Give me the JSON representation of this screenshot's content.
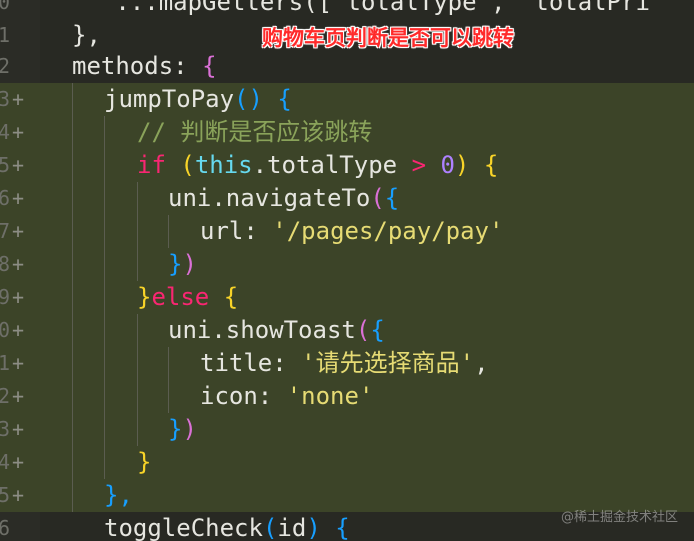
{
  "annotation": "购物车页判断是否可以跳转",
  "watermark": "@稀土掘金技术社区",
  "lines": [
    {
      "num": "0",
      "mark": "",
      "tokens": {
        "a": "   ...mapGetters([ totalType ,  totalPri"
      }
    },
    {
      "num": "1",
      "mark": "",
      "tokens": {
        "a": "},"
      }
    },
    {
      "num": "2",
      "mark": "",
      "tokens": {
        "a": "methods",
        "b": ":",
        "c": "{"
      }
    },
    {
      "num": "3",
      "mark": "+",
      "tokens": {
        "a": "jumpToPay",
        "b": "()",
        "c": "{"
      }
    },
    {
      "num": "4",
      "mark": "+",
      "tokens": {
        "a": "// 判断是否应该跳转"
      }
    },
    {
      "num": "5",
      "mark": "+",
      "tokens": {
        "a": "if",
        "b": "(",
        "c": "this",
        "d": ".totalType",
        "e": ">",
        "f": "0",
        "g": ")",
        "h": "{"
      }
    },
    {
      "num": "6",
      "mark": "+",
      "tokens": {
        "a": "uni",
        "b": ".navigateTo",
        "c": "(",
        "d": "{"
      }
    },
    {
      "num": "7",
      "mark": "+",
      "tokens": {
        "a": "url",
        "b": ":",
        "c": "'/pages/pay/pay'"
      }
    },
    {
      "num": "8",
      "mark": "+",
      "tokens": {
        "a": "}",
        "b": ")"
      }
    },
    {
      "num": "9",
      "mark": "+",
      "tokens": {
        "a": "}",
        "b": "else",
        "c": "{"
      }
    },
    {
      "num": "0",
      "mark": "+",
      "tokens": {
        "a": "uni",
        "b": ".showToast",
        "c": "(",
        "d": "{"
      }
    },
    {
      "num": "1",
      "mark": "+",
      "tokens": {
        "a": "title",
        "b": ":",
        "c": "'请先选择商品'",
        "d": ","
      }
    },
    {
      "num": "2",
      "mark": "+",
      "tokens": {
        "a": "icon",
        "b": ":",
        "c": "'none'"
      }
    },
    {
      "num": "3",
      "mark": "+",
      "tokens": {
        "a": "}",
        "b": ")"
      }
    },
    {
      "num": "4",
      "mark": "+",
      "tokens": {
        "a": "}"
      }
    },
    {
      "num": "5",
      "mark": "+",
      "tokens": {
        "a": "},"
      }
    },
    {
      "num": "6",
      "mark": "",
      "tokens": {
        "a": "toggleCheck",
        "b": "(",
        "c": "id",
        "d": ")",
        "e": "{"
      }
    }
  ],
  "colors": {
    "background": "#282923",
    "added_line": "#3c4428",
    "annotation": "#ff2a2a"
  }
}
